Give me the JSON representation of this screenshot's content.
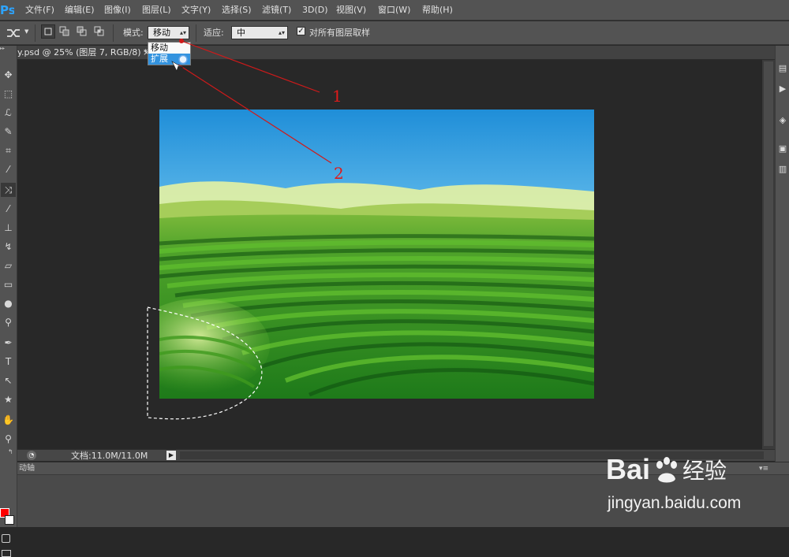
{
  "app": {
    "logo_text": "Ps"
  },
  "menu": [
    "文件(F)",
    "编辑(E)",
    "图像(I)",
    "图层(L)",
    "文字(Y)",
    "选择(S)",
    "滤镜(T)",
    "3D(D)",
    "视图(V)",
    "窗口(W)",
    "帮助(H)"
  ],
  "options": {
    "mode_label": "模式:",
    "mode_value": "移动",
    "adapt_label": "适应:",
    "adapt_value": "中",
    "sample_all_label": "对所有图层取样",
    "sample_all_checked": "✓"
  },
  "mode_dropdown": {
    "options": [
      "移动",
      "扩展"
    ],
    "highlighted": "扩展"
  },
  "document": {
    "tab_title": "y.psd @ 25% (图层 7, RGB/8) *",
    "close_glyph": "×"
  },
  "status": {
    "doc_size": "文档:11.0M/11.0M"
  },
  "bottom_panel": {
    "title": "动轴"
  },
  "annotations": {
    "label_1": "1",
    "label_2": "2"
  },
  "colors": {
    "foreground": "#ff0000",
    "background": "#ffffff",
    "highlight": "#3393df",
    "annotation": "#e01a1a"
  },
  "watermark": {
    "brand_left": "Bai",
    "brand_right": "经验",
    "url": "jingyan.baidu.com"
  }
}
